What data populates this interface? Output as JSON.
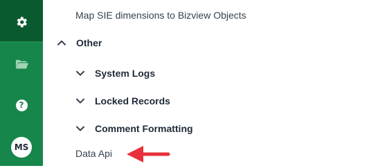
{
  "sidebar": {
    "avatar_initials": "MS",
    "help_glyph": "?",
    "icons": [
      "gear-icon",
      "folder-icon",
      "help-icon"
    ],
    "colors": {
      "rail": "#16864a",
      "rail_active": "#0a5a2f"
    }
  },
  "menu": {
    "map_link": "Map SIE dimensions to Bizview Objects",
    "other_label": "Other",
    "subgroups": [
      "System Logs",
      "Locked Records",
      "Comment Formatting"
    ],
    "data_api_link": "Data Api"
  },
  "annotation": {
    "arrow_color": "#e8303a"
  }
}
